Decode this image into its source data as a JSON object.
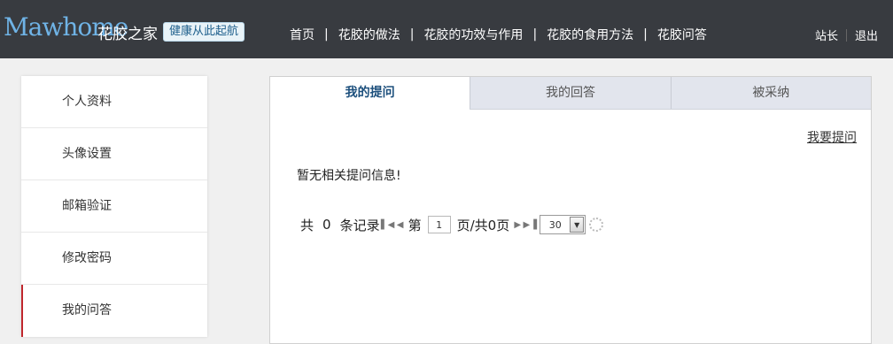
{
  "header": {
    "logo": "Mawhome",
    "logo_cn": "花胶之家",
    "slogan": "健康从此起航",
    "nav": [
      "首页",
      "花胶的做法",
      "花胶的功效与作用",
      "花胶的食用方法",
      "花胶问答"
    ],
    "nav_sep": "|",
    "user_links": [
      "站长",
      "退出"
    ]
  },
  "sidebar": {
    "items": [
      {
        "label": "个人资料"
      },
      {
        "label": "头像设置"
      },
      {
        "label": "邮箱验证"
      },
      {
        "label": "修改密码"
      },
      {
        "label": "我的问答"
      }
    ],
    "active_index": 4
  },
  "main": {
    "tabs": [
      "我的提问",
      "我的回答",
      "被采纳"
    ],
    "active_tab": 0,
    "ask_link": "我要提问",
    "empty_message": "暂无相关提问信息!",
    "pager": {
      "total_prefix": "共",
      "total": "0",
      "total_suffix": "条记录",
      "page_prefix": "第",
      "page_value": "1",
      "page_suffix": "页/共0页",
      "page_size": "30"
    }
  }
}
